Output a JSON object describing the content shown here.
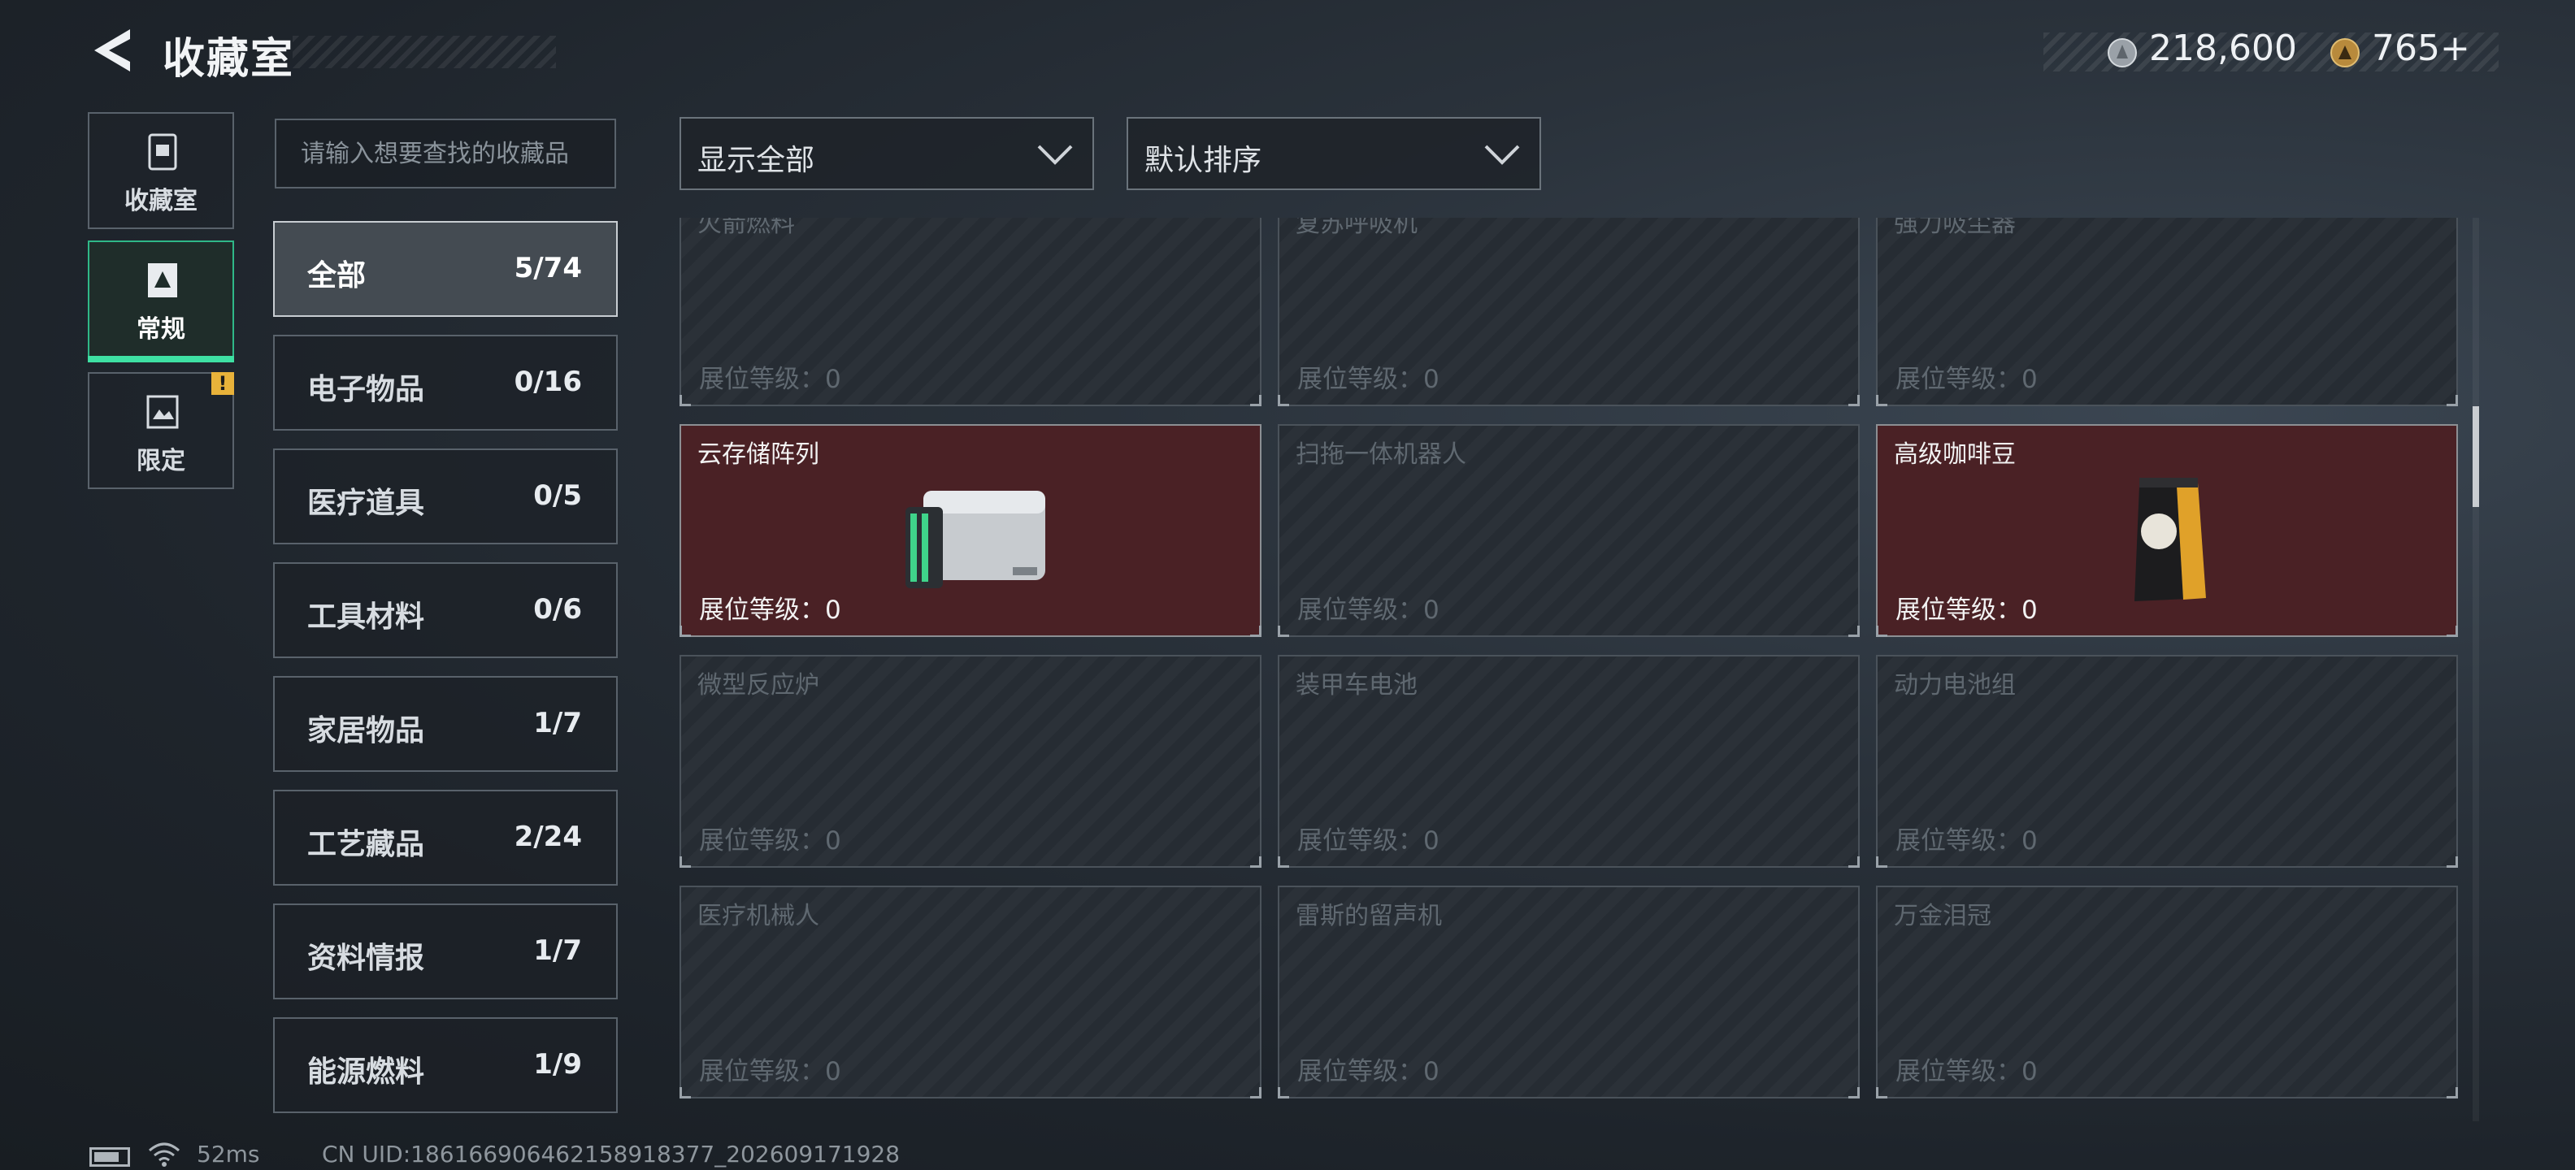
{
  "header": {
    "title": "收藏室",
    "currency_1": {
      "icon": "silver-coin-icon",
      "value": "218,600"
    },
    "currency_2": {
      "icon": "gold-triangle-coin-icon",
      "value": "765+"
    }
  },
  "nav": {
    "items": [
      {
        "label": "收藏室",
        "icon": "collection-room-icon"
      },
      {
        "label": "常规",
        "icon": "standard-card-icon",
        "active": true
      },
      {
        "label": "限定",
        "icon": "limited-card-icon",
        "badge": "!"
      }
    ]
  },
  "search": {
    "placeholder": "请输入想要查找的收藏品"
  },
  "filters": {
    "show": "显示全部",
    "sort": "默认排序"
  },
  "categories": [
    {
      "label": "全部",
      "count": "5/74",
      "active": true
    },
    {
      "label": "电子物品",
      "count": "0/16"
    },
    {
      "label": "医疗道具",
      "count": "0/5"
    },
    {
      "label": "工具材料",
      "count": "0/6"
    },
    {
      "label": "家居物品",
      "count": "1/7"
    },
    {
      "label": "工艺藏品",
      "count": "2/24"
    },
    {
      "label": "资料情报",
      "count": "1/7"
    },
    {
      "label": "能源燃料",
      "count": "1/9"
    }
  ],
  "grid": {
    "level_prefix": "展位等级：",
    "rows": [
      [
        {
          "name": "火箭燃料",
          "level": "0",
          "owned": false
        },
        {
          "name": "复苏呼吸机",
          "level": "0",
          "owned": false
        },
        {
          "name": "强力吸尘器",
          "level": "0",
          "owned": false
        }
      ],
      [
        {
          "name": "云存储阵列",
          "level": "0",
          "owned": true,
          "icon": "storage-array-icon"
        },
        {
          "name": "扫拖一体机器人",
          "level": "0",
          "owned": false
        },
        {
          "name": "高级咖啡豆",
          "level": "0",
          "owned": true,
          "icon": "coffee-bag-icon"
        }
      ],
      [
        {
          "name": "微型反应炉",
          "level": "0",
          "owned": false
        },
        {
          "name": "装甲车电池",
          "level": "0",
          "owned": false
        },
        {
          "name": "动力电池组",
          "level": "0",
          "owned": false
        }
      ],
      [
        {
          "name": "医疗机械人",
          "level": "0",
          "owned": false
        },
        {
          "name": "雷斯的留声机",
          "level": "0",
          "owned": false
        },
        {
          "name": "万金泪冠",
          "level": "0",
          "owned": false
        }
      ]
    ]
  },
  "footer": {
    "ping": "52ms",
    "uid": "CN UID:18616690646215891837​7_202609171928"
  }
}
